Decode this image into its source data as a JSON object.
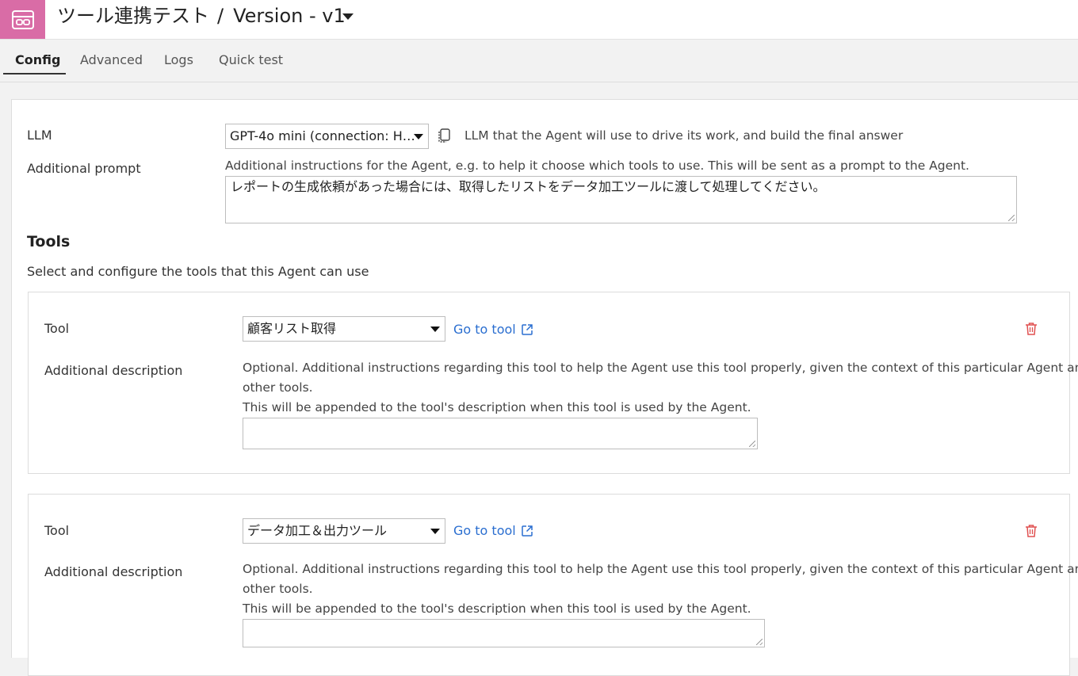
{
  "header": {
    "project_name": "ツール連携テスト",
    "separator": "/",
    "version": "Version - v1",
    "app_icon": "agent-icon"
  },
  "tabs": [
    {
      "label": "Config",
      "active": true
    },
    {
      "label": "Advanced",
      "active": false
    },
    {
      "label": "Logs",
      "active": false
    },
    {
      "label": "Quick test",
      "active": false
    }
  ],
  "llm": {
    "label": "LLM",
    "selected": "GPT-4o mini (connection: H…",
    "help": "LLM that the Agent will use to drive its work, and build the final answer",
    "copy_icon": "copy-icon"
  },
  "additional_prompt": {
    "label": "Additional prompt",
    "help": "Additional instructions for the Agent, e.g. to help it choose which tools to use. This will be sent as a prompt to the Agent.",
    "value": "レポートの生成依頼があった場合には、取得したリストをデータ加工ツールに渡して処理してください。"
  },
  "tools_section": {
    "title": "Tools",
    "subtitle": "Select and configure the tools that this Agent can use"
  },
  "tools": [
    {
      "label": "Tool",
      "selected": "顧客リスト取得",
      "goto_label": "Go to tool",
      "desc_label": "Additional description",
      "desc_help_line1": "Optional. Additional instructions regarding this tool to help the Agent use this tool properly, given the context of this particular Agent and its",
      "desc_help_line2": "other tools.",
      "desc_help_line3": "This will be appended to the tool's description when this tool is used by the Agent.",
      "desc_value": ""
    },
    {
      "label": "Tool",
      "selected": "データ加工＆出力ツール",
      "goto_label": "Go to tool",
      "desc_label": "Additional description",
      "desc_help_line1": "Optional. Additional instructions regarding this tool to help the Agent use this tool properly, given the context of this particular Agent and its",
      "desc_help_line2": "other tools.",
      "desc_help_line3": "This will be appended to the tool's description when this tool is used by the Agent.",
      "desc_value": ""
    }
  ],
  "colors": {
    "brand": "#d96ca6",
    "link": "#2a6ed0",
    "danger": "#e05050"
  }
}
